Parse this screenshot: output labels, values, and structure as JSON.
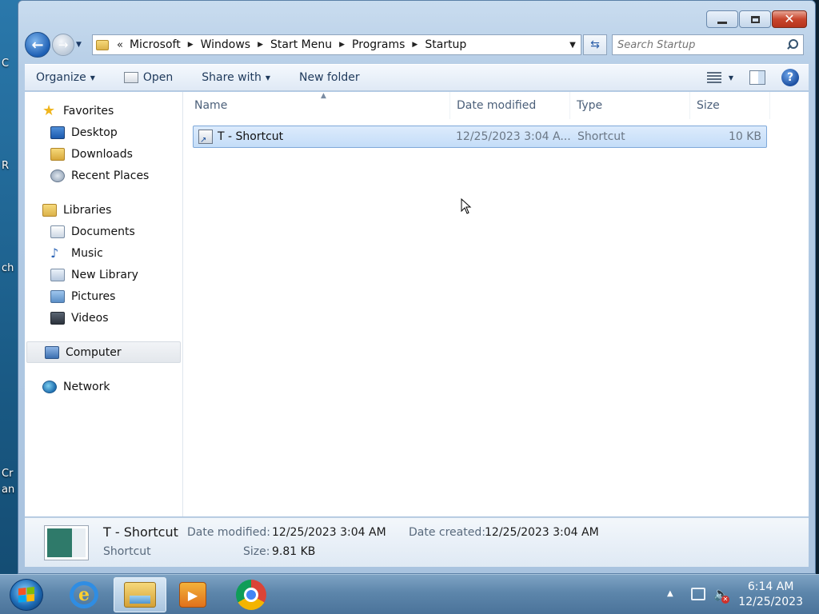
{
  "desktop": {
    "fragments": [
      "C",
      "R",
      "ch",
      "Cr",
      "an"
    ]
  },
  "window": {
    "caption": {
      "minimize_icon": "minimize-icon",
      "maximize_icon": "maximize-icon",
      "close_icon": "close-icon"
    },
    "nav": {
      "breadcrumb_chevron": "«",
      "breadcrumbs": [
        "Microsoft",
        "Windows",
        "Start Menu",
        "Programs",
        "Startup"
      ],
      "search_placeholder": "Search Startup"
    },
    "toolbar": {
      "organize": "Organize",
      "open": "Open",
      "share_with": "Share with",
      "new_folder": "New folder"
    },
    "sidebar": {
      "favorites": {
        "label": "Favorites",
        "items": [
          "Desktop",
          "Downloads",
          "Recent Places"
        ]
      },
      "libraries": {
        "label": "Libraries",
        "items": [
          "Documents",
          "Music",
          "New Library",
          "Pictures",
          "Videos"
        ]
      },
      "computer": "Computer",
      "network": "Network"
    },
    "columns": {
      "name": "Name",
      "date_modified": "Date modified",
      "type": "Type",
      "size": "Size"
    },
    "files": [
      {
        "name": "T - Shortcut",
        "date_modified": "12/25/2023 3:04 A...",
        "type": "Shortcut",
        "size": "10 KB",
        "selected": true
      }
    ],
    "details": {
      "title": "T - Shortcut",
      "type": "Shortcut",
      "date_modified_label": "Date modified:",
      "date_modified_value": "12/25/2023 3:04 AM",
      "date_created_label": "Date created:",
      "date_created_value": "12/25/2023 3:04 AM",
      "size_label": "Size:",
      "size_value": "9.81 KB"
    }
  },
  "taskbar": {
    "apps": [
      "internet-explorer",
      "windows-explorer",
      "windows-media-player",
      "google-chrome"
    ],
    "clock_time": "6:14 AM",
    "clock_date": "12/25/2023"
  },
  "colors": {
    "selection_bg": "#c4ddf8",
    "selection_border": "#7fa9d9",
    "window_chrome": "#b5cde6",
    "close_button": "#c8452c"
  }
}
